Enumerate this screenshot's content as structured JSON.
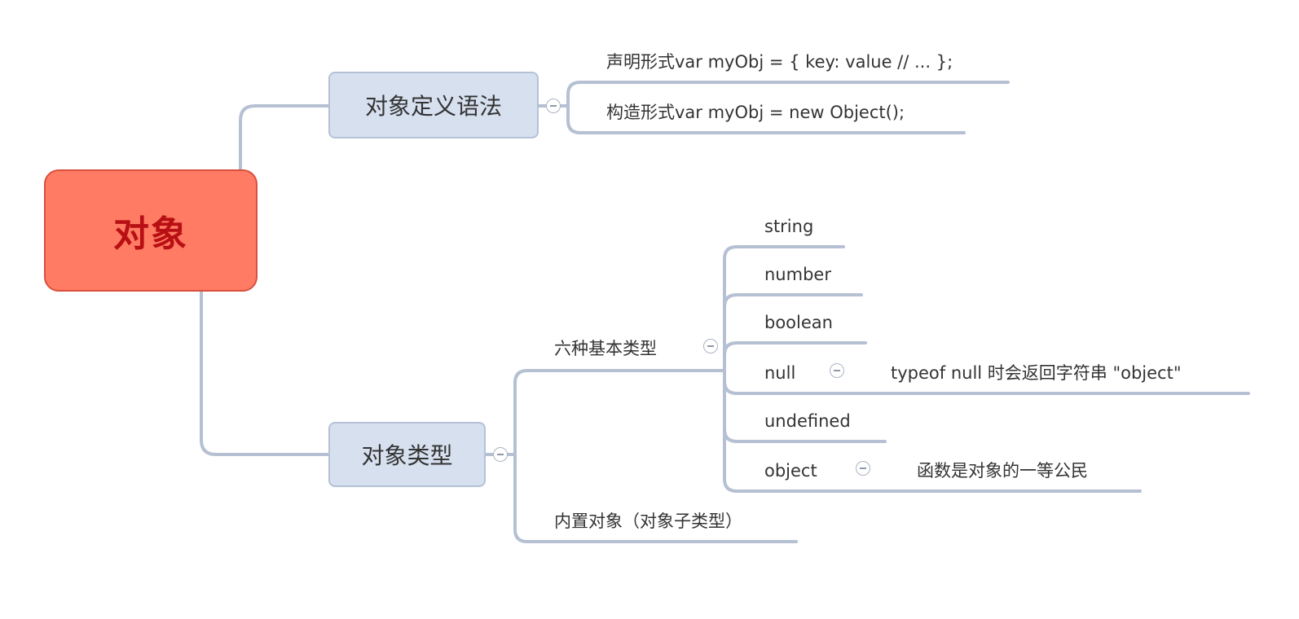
{
  "mindmap": {
    "root": {
      "label": "对象"
    },
    "branches": [
      {
        "label": "对象定义语法",
        "children": [
          {
            "label": "声明形式var myObj = { key: value // ... };"
          },
          {
            "label": "构造形式var myObj = new Object();"
          }
        ]
      },
      {
        "label": "对象类型",
        "children": [
          {
            "label": "六种基本类型",
            "children": [
              {
                "label": "string"
              },
              {
                "label": "number"
              },
              {
                "label": "boolean"
              },
              {
                "label": "null",
                "note": "typeof null 时会返回字符串 \"object\""
              },
              {
                "label": "undefined"
              },
              {
                "label": "object",
                "note": "函数是对象的一等公民"
              }
            ]
          },
          {
            "label": "内置对象（对象子类型）"
          }
        ]
      }
    ]
  },
  "colors": {
    "root_fill": "#ff7b63",
    "root_text": "#b80f14",
    "branch_fill": "#d6e0ef",
    "connector": "#b5c0d2"
  },
  "icons": {
    "collapse": "collapse-minus-icon"
  }
}
